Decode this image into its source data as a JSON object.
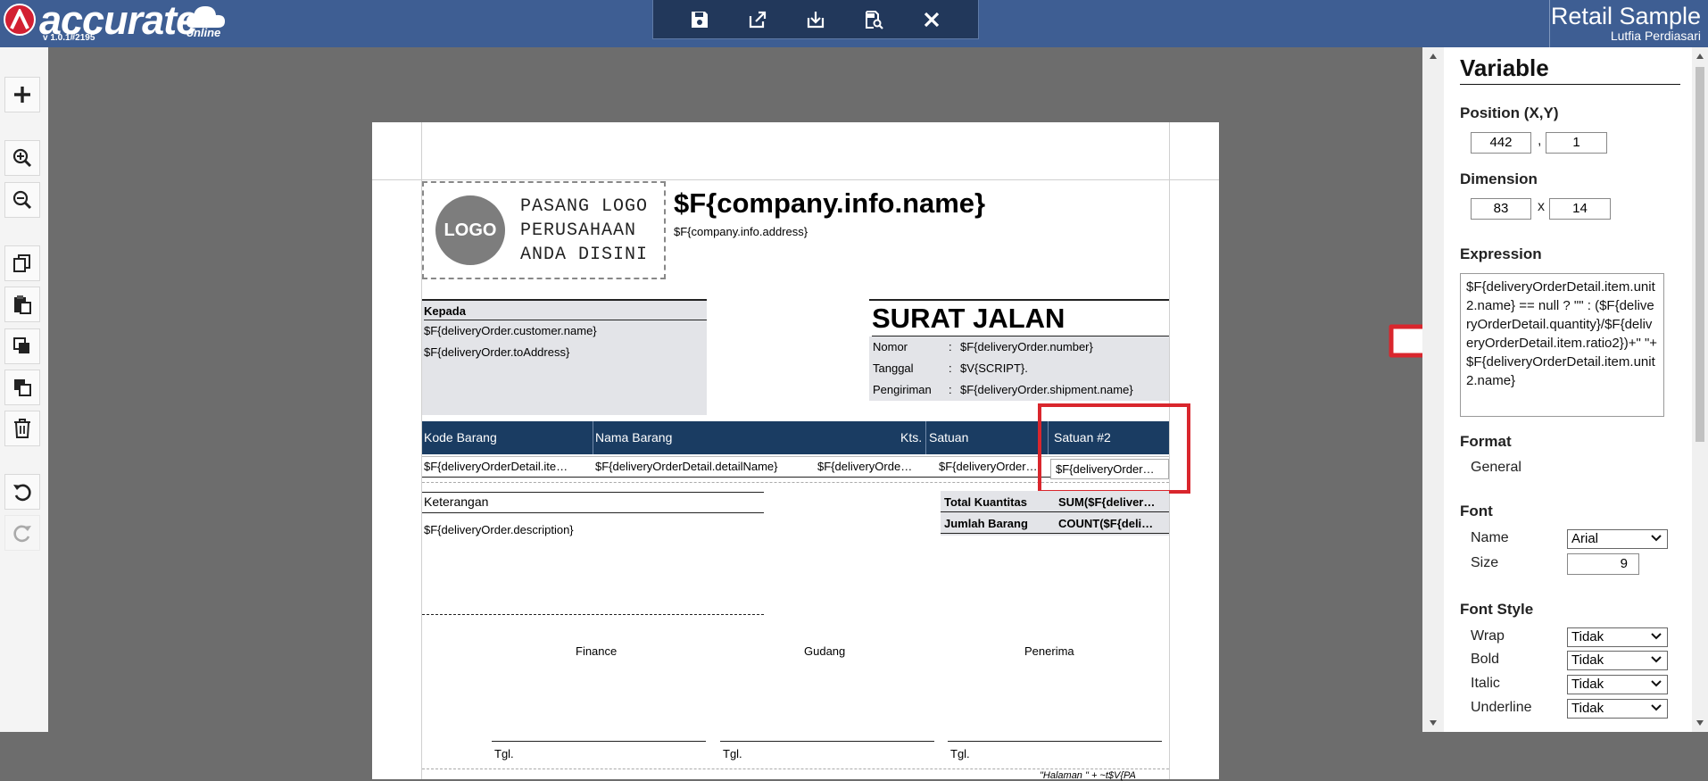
{
  "app": {
    "brand": "accurate",
    "brand_suffix": "online",
    "version": "v 1.0.1#2195",
    "company": "Retail Sample",
    "user": "Lutfia Perdiasari"
  },
  "toolbar": {
    "icons": [
      "save-icon",
      "export-icon",
      "download-icon",
      "preview-icon",
      "close-icon"
    ]
  },
  "left_tools": [
    "add",
    "zoom-in",
    "zoom-out",
    "copy",
    "paste",
    "bring-front",
    "send-back",
    "delete",
    "undo",
    "redo"
  ],
  "page": {
    "logo_text": "LOGO",
    "logo_line1": "PASANG LOGO",
    "logo_line2": "PERUSAHAAN",
    "logo_line3": "ANDA DISINI",
    "company_name": "$F{company.info.name}",
    "company_address": "$F{company.info.address}",
    "kepada_label": "Kepada",
    "customer_name": "$F{deliveryOrder.customer.name}",
    "to_address": "$F{deliveryOrder.toAddress}",
    "title": "SURAT JALAN",
    "info": [
      {
        "label": "Nomor",
        "sep": ":",
        "value": "$F{deliveryOrder.number}"
      },
      {
        "label": "Tanggal",
        "sep": ":",
        "value": "$V{SCRIPT}."
      },
      {
        "label": "Pengiriman",
        "sep": ":",
        "value": "$F{deliveryOrder.shipment.name}"
      }
    ],
    "columns": [
      "Kode Barang",
      "Nama Barang",
      "Kts.",
      "Satuan",
      "Satuan #2"
    ],
    "row": [
      "$F{deliveryOrderDetail.ite…",
      "$F{deliveryOrderDetail.detailName}",
      "$F{deliveryOrde…",
      "$F{deliveryOrder…",
      "$F{deliveryOrder…"
    ],
    "keterangan_label": "Keterangan",
    "description": "$F{deliveryOrder.description}",
    "total_qty_label": "Total Kuantitas",
    "total_qty_value": "SUM($F{deliver…",
    "item_count_label": "Jumlah Barang",
    "item_count_value": "COUNT($F{deli…",
    "signatures": [
      "Finance",
      "Gudang",
      "Penerima"
    ],
    "tgl": "Tgl.",
    "footer": "\"Halaman \" + ~t$V{PA"
  },
  "panel": {
    "title": "Variable",
    "position_label": "Position (X,Y)",
    "pos_x": "442",
    "pos_sep": ",",
    "pos_y": "1",
    "dimension_label": "Dimension",
    "dim_w": "83",
    "dim_sep": "x",
    "dim_h": "14",
    "expression_label": "Expression",
    "expression": "$F{deliveryOrderDetail.item.unit2.name} == null ? \"\" : ($F{deliveryOrderDetail.quantity}/$F{deliveryOrderDetail.item.ratio2})+\" \"+$F{deliveryOrderDetail.item.unit2.name}",
    "format_label": "Format",
    "format_value": "General",
    "font_label": "Font",
    "font_name_label": "Name",
    "font_name_value": "Arial",
    "font_size_label": "Size",
    "font_size_value": "9",
    "font_style_label": "Font Style",
    "wrap_label": "Wrap",
    "wrap_value": "Tidak",
    "bold_label": "Bold",
    "bold_value": "Tidak",
    "italic_label": "Italic",
    "italic_value": "Tidak",
    "underline_label": "Underline",
    "underline_value": "Tidak"
  },
  "colors": {
    "topbar": "#3e5e93",
    "toolbar": "#22385b",
    "table_header": "#1a3c62",
    "highlight": "#d9262d",
    "brand_red": "#d32032"
  }
}
